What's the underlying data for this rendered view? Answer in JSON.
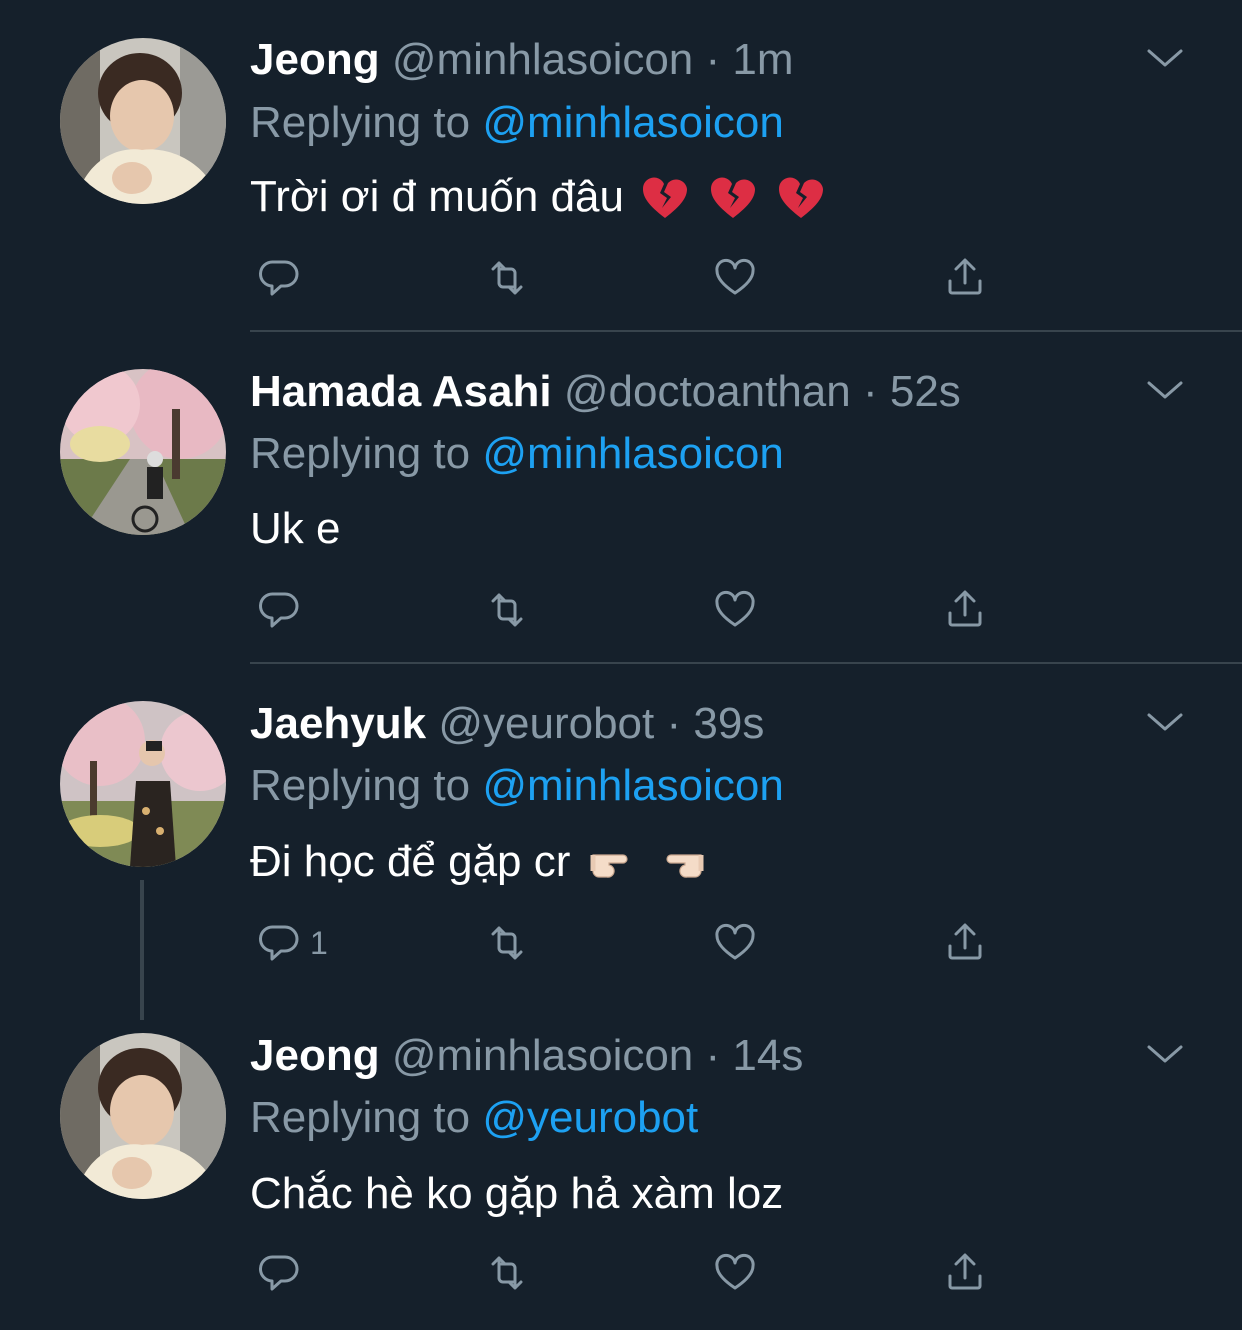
{
  "tweets": [
    {
      "name": "Jeong",
      "handle": "@minhlasoicon",
      "time": "1m",
      "replying_prefix": "Replying to ",
      "replying_to": "@minhlasoicon",
      "text": "Trời ơi đ muốn đâu",
      "emoji": [
        "broken-heart",
        "broken-heart",
        "broken-heart"
      ],
      "reply_count": "",
      "avatar": "person-cream-sweater"
    },
    {
      "name": "Hamada Asahi",
      "handle": "@doctoanthan",
      "time": "52s",
      "replying_prefix": "Replying to ",
      "replying_to": "@minhlasoicon",
      "text": "Uk e",
      "emoji": [],
      "reply_count": "",
      "avatar": "cherry-blossom-path-cyclist"
    },
    {
      "name": "Jaehyuk",
      "handle": "@yeurobot",
      "time": "39s",
      "replying_prefix": "Replying to ",
      "replying_to": "@minhlasoicon",
      "text": "Đi học để gặp cr",
      "emoji": [
        "pointing-right",
        "pointing-left"
      ],
      "reply_count": "1",
      "avatar": "cherry-blossom-person"
    },
    {
      "name": "Jeong",
      "handle": "@minhlasoicon",
      "time": "14s",
      "replying_prefix": "Replying to ",
      "replying_to": "@yeurobot",
      "text": "Chắc hè ko gặp hả xàm loz",
      "emoji": [],
      "reply_count": "",
      "avatar": "person-cream-sweater"
    }
  ],
  "separator": "·",
  "colors": {
    "background": "#15202b",
    "secondary_text": "#8899a6",
    "mention": "#1da1f2",
    "divider": "#38444d"
  },
  "icons": [
    "reply-icon",
    "retweet-icon",
    "like-icon",
    "share-icon",
    "chevron-down-icon"
  ]
}
